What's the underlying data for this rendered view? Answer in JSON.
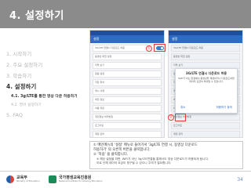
{
  "header": {
    "title": "4. 설정하기"
  },
  "toc": {
    "items": [
      {
        "label": "1.  시작하기",
        "state": "inactive"
      },
      {
        "label": "2.  주요 설정하기",
        "state": "inactive"
      },
      {
        "label": "3.  학습하기",
        "state": "inactive"
      },
      {
        "label": "4.  설정하기",
        "state": "active"
      },
      {
        "label": "4.1. 3g/LTE를 통한 영상 다운 허용하기",
        "state": "active-sub"
      },
      {
        "label": "4.2. 영어 설정하기",
        "state": "inactive-sub"
      },
      {
        "label": "5.  FAQ",
        "state": "inactive"
      }
    ]
  },
  "phone_left": {
    "appbar": "설정",
    "rows": [
      "3G/LTE 연결시 다운로드 허용",
      "동영상 화질 설정",
      "자막 보기",
      "알림 설정",
      "저장 위치",
      "캐시 삭제",
      "버전 정보",
      "이용 약관",
      "개인정보 처리방침",
      "로그아웃",
      "계정 관리",
      "도움말"
    ]
  },
  "phone_right": {
    "appbar": "설정",
    "rows": [
      "3G/LTE 연결시 다운로드 허용",
      "동영상 화질 설정",
      "자막 보기",
      "알림 설정",
      "저장 위치",
      "캐시 삭제",
      "버전 정보",
      "이용 약관",
      "개인정보 처리방침",
      "로그아웃",
      "계정 관리",
      "도움말"
    ],
    "dialog": {
      "title": "3G/LTE 연결시 다운로드 허용",
      "body": "WiFi가 아닌 환경에서 동영상을 재생하거나 다운로드하면 데이터 요금이 부과될 수 있습니다.",
      "cancel": "취소",
      "confirm": "허용하기 동의"
    }
  },
  "markers": {
    "one": "①",
    "two": "②"
  },
  "caption": {
    "line1": "① 메인메뉴의 '설정' 메뉴로 들어가서 '3g/LTE 연결 시, 동영상 다운로드",
    "line2": "    허용하기' 의 오른쪽 버튼을 클릭합니다.",
    "line3": "② '허용' 을 클릭합니다.",
    "note1": "※ 해당 설정을 하면, WiFi가 아닌 3g/LTE연결을 통해서도 영상 다운로드가 허용되게 됩니다.",
    "note2": "    이로 인해 데이터 요금이 청구될 수 있으니 주의가 필요합니다."
  },
  "footer": {
    "logo1_name": "교육부",
    "logo1_sub": "Ministry of Education",
    "logo2_name": "국가평생교육진흥원",
    "logo2_sub": "National Institute for Lifelong Education",
    "page": "34"
  },
  "colors": {
    "header": "#8b8b8b",
    "accent_red": "#e23b3b",
    "app_blue": "#2e6bc6",
    "page_num": "#6a8cc0"
  }
}
